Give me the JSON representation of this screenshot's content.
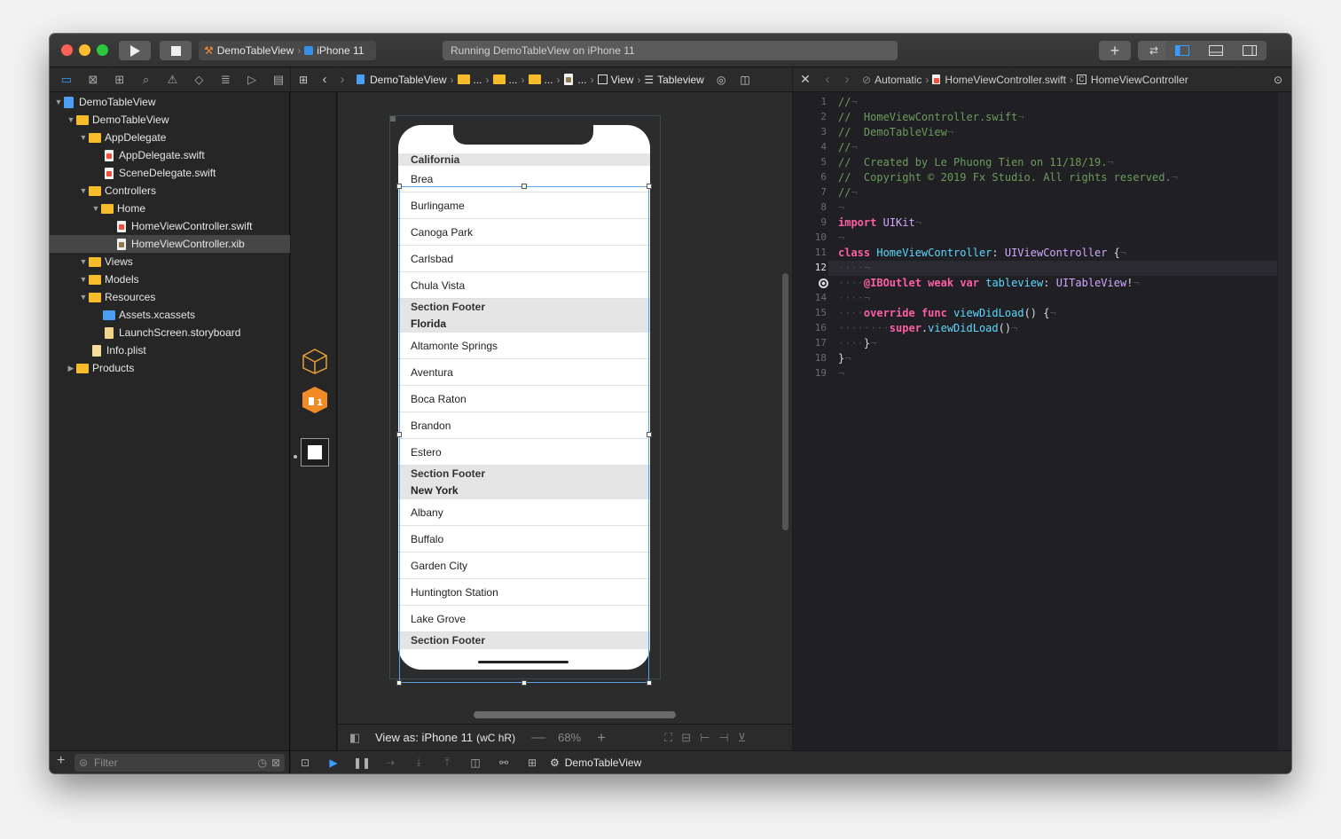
{
  "toolbar": {
    "scheme_name": "DemoTableView",
    "device": "iPhone 11",
    "activity_status": "Running DemoTableView on iPhone 11"
  },
  "navigator": {
    "items": [
      {
        "label": "DemoTableView",
        "kind": "project"
      },
      {
        "label": "DemoTableView",
        "kind": "folder"
      },
      {
        "label": "AppDelegate",
        "kind": "folder"
      },
      {
        "label": "AppDelegate.swift",
        "kind": "swift"
      },
      {
        "label": "SceneDelegate.swift",
        "kind": "swift"
      },
      {
        "label": "Controllers",
        "kind": "folder"
      },
      {
        "label": "Home",
        "kind": "folder"
      },
      {
        "label": "HomeViewController.swift",
        "kind": "swift"
      },
      {
        "label": "HomeViewController.xib",
        "kind": "xib"
      },
      {
        "label": "Views",
        "kind": "folder"
      },
      {
        "label": "Models",
        "kind": "folder"
      },
      {
        "label": "Resources",
        "kind": "folder"
      },
      {
        "label": "Assets.xcassets",
        "kind": "assets"
      },
      {
        "label": "LaunchScreen.storyboard",
        "kind": "storyboard"
      },
      {
        "label": "Info.plist",
        "kind": "plist"
      },
      {
        "label": "Products",
        "kind": "folder"
      }
    ],
    "filter_placeholder": "Filter"
  },
  "jumpbar": {
    "project": "DemoTableView",
    "ellipsis": "...",
    "view": "View",
    "tableview": "Tableview"
  },
  "canvas": {
    "sections": [
      {
        "header": "California",
        "rows": [
          "Brea",
          "Burlingame",
          "Canoga Park",
          "Carlsbad",
          "Chula Vista"
        ],
        "footer": "Section Footer"
      },
      {
        "header": "Florida",
        "rows": [
          "Altamonte Springs",
          "Aventura",
          "Boca Raton",
          "Brandon",
          "Estero"
        ],
        "footer": "Section Footer"
      },
      {
        "header": "New York",
        "rows": [
          "Albany",
          "Buffalo",
          "Garden City",
          "Huntington Station",
          "Lake Grove"
        ],
        "footer": "Section Footer"
      }
    ],
    "view_as": "View as: iPhone 11",
    "size_class": "(wC hR)",
    "zoom": "68%"
  },
  "editor": {
    "breadcrumb_mode": "Automatic",
    "breadcrumb_file": "HomeViewController.swift",
    "breadcrumb_class": "HomeViewController",
    "line_numbers": [
      "1",
      "2",
      "3",
      "4",
      "5",
      "6",
      "7",
      "8",
      "9",
      "10",
      "11",
      "12",
      "",
      "14",
      "15",
      "16",
      "17",
      "18",
      "19"
    ],
    "lines": [
      "//",
      "//  HomeViewController.swift",
      "//  DemoTableView",
      "//",
      "//  Created by Le Phuong Tien on 11/18/19.",
      "//  Copyright © 2019 Fx Studio. All rights reserved.",
      "//",
      "",
      "import UIKit",
      "",
      "class HomeViewController: UIViewController {",
      "",
      "@IBOutlet weak var tableview: UITableView!",
      "",
      "override func viewDidLoad() {",
      "super.viewDidLoad()",
      "}",
      "}",
      ""
    ],
    "current_line": "12"
  },
  "debugbar": {
    "target": "DemoTableView"
  }
}
